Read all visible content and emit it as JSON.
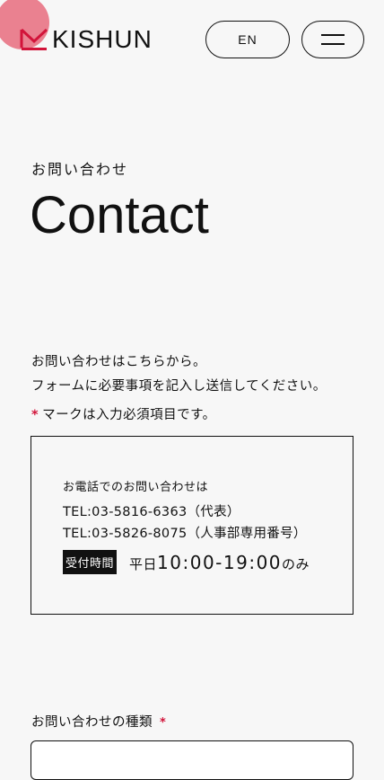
{
  "header": {
    "brand": "KISHUN",
    "brand_color": "#d2143a",
    "lang_label": "EN",
    "menu_icon": "hamburger-icon"
  },
  "hero": {
    "eyebrow": "お問い合わせ",
    "title": "Contact"
  },
  "intro": {
    "line1": "お問い合わせはこちらから。",
    "line2": "フォームに必要事項を記入し送信してください。",
    "required_star": "*",
    "required_text": "マークは入力必須項目です。"
  },
  "phone_box": {
    "heading": "お電話でのお問い合わせは",
    "tel_main": "TEL:03-5816-6363（代表）",
    "tel_hr": "TEL:03-5826-8075（人事部専用番号）",
    "hours_badge": "受付時間",
    "hours_prefix": "平日",
    "hours_time": "10:00-19:00",
    "hours_suffix": "のみ"
  },
  "form": {
    "inquiry_type_label": "お問い合わせの種類",
    "required_star": "*"
  }
}
